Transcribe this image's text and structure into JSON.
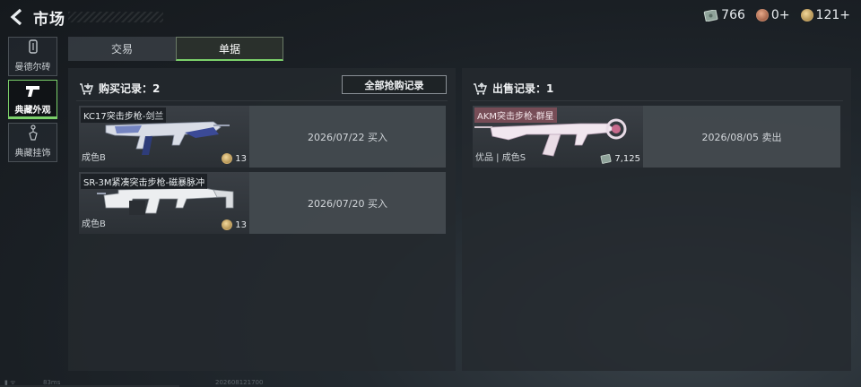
{
  "header": {
    "title": "市场"
  },
  "currencies": [
    {
      "icon": "banknote-icon",
      "value": "766"
    },
    {
      "icon": "copper-coin-icon",
      "value": "0+"
    },
    {
      "icon": "gold-coin-icon",
      "value": "121+"
    }
  ],
  "sidebar": {
    "items": [
      {
        "label": "曼德尔砖",
        "icon": "mandel-brick-icon",
        "active": false
      },
      {
        "label": "典藏外观",
        "icon": "pistol-icon",
        "active": true
      },
      {
        "label": "典藏挂饰",
        "icon": "charm-icon",
        "active": false
      }
    ]
  },
  "tabs": [
    {
      "label": "交易",
      "active": false
    },
    {
      "label": "单据",
      "active": true
    }
  ],
  "purchase": {
    "title": "购买记录：2",
    "all_button": "全部抢购记录",
    "records": [
      {
        "name": "KC17突击步枪-剑兰",
        "grade": "成色B",
        "price": "13",
        "info": "2026/07/22 买入"
      },
      {
        "name": "SR-3M紧凑突击步枪-磁暴脉冲",
        "grade": "成色B",
        "price": "13",
        "info": "2026/07/20 买入"
      }
    ]
  },
  "sale": {
    "title": "出售记录：1",
    "records": [
      {
        "name": "AKM突击步枪-群星",
        "grade": "优品 | 成色S",
        "price": "7,125",
        "info": "2026/08/05 卖出"
      }
    ]
  },
  "status": {
    "ping": "83ms",
    "code": "202608121700"
  },
  "colors": {
    "accent": "#7bd06a",
    "panel": "#24292e",
    "info_bg": "#4e545a"
  }
}
